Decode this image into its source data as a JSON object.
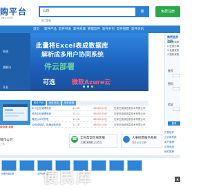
{
  "header": {
    "logo": "购平台",
    "logo_sub": "iwu.com",
    "search_category": "公司",
    "search_placeholder": "",
    "search_button": "搜",
    "hot_label": "热门搜索",
    "register_button": "免费注册"
  },
  "nav": [
    "首页",
    "软件产品",
    "软件开发",
    "软件商城",
    "管理软件",
    "软件外包",
    "软件招聘",
    "软件资讯"
  ],
  "sidebar": {
    "items": [
      "",
      "",
      "系统",
      "",
      "统解决",
      "",
      "",
      "开发"
    ],
    "price": "000.00",
    "note": "製作公司",
    "note_sub": "工作"
  },
  "banner": {
    "line1": "此量将Excel表成数据库",
    "line2": "解析成多用户协同系统",
    "line3": "件云部署",
    "line4": "",
    "line5_left": "可选",
    "line5_right": "微软Azure云"
  },
  "login": {
    "title": "商贸会员注册",
    "lines": [
      "1.联系卖家",
      "2.在线下单",
      "3.免费发布",
      "4.招标采购"
    ],
    "user_label": "账号",
    "pass_label": "密码",
    "code_label": "验证",
    "button": "登录"
  },
  "table": {
    "tabs": [
      "软件产品",
      "软件开发",
      "软件商城"
    ],
    "rows": [
      {
        "name": "中小企业管理系统",
        "date": "11-06",
        "price": "48000.00元",
        "company": "石家庄极致信息技术有限公司"
      },
      {
        "name": "科技企业管理系统",
        "date": "11-11",
        "price": "48000.00元",
        "company": "石家庄极致信息技术有限公司"
      },
      {
        "name": "微信公众号开发",
        "date": "11-16",
        "price": "48000.00元",
        "company": "石家庄极致信息技术有限公司"
      },
      {
        "name": "云转转系统，极速运转系统",
        "date": "11-18",
        "price": "48000.00元",
        "company": "石家庄极致信息技术有限公司"
      }
    ]
  },
  "contact": {
    "title": "全民帮帮在线客服",
    "phone": "13630812351"
  },
  "jobs": {
    "title": "人事招聘服务系统",
    "sub": "更多软件招聘"
  },
  "tiles": [
    "智能管理系统",
    "",
    "资产管理系统",
    "",
    "",
    "",
    "",
    ""
  ],
  "recommend": [
    "开发软件",
    "云计算系统",
    "用户管理",
    "应用系统",
    "软件推荐",
    "定制开发"
  ],
  "watermark": "便民库",
  "colors": {
    "brand": "#1a63b8",
    "nav": "#2b7fd1",
    "register": "#2ba84a",
    "price": "#d9534f"
  }
}
